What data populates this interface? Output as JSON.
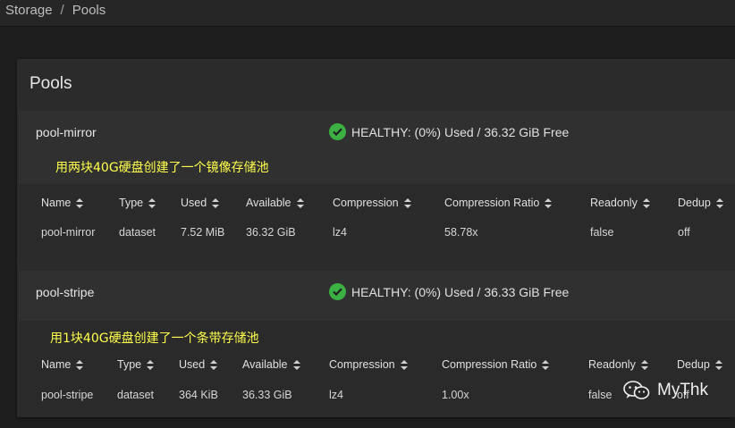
{
  "breadcrumb": {
    "items": [
      "Storage",
      "Pools"
    ],
    "separator": "/"
  },
  "card": {
    "title": "Pools"
  },
  "columns": [
    "Name",
    "Type",
    "Used",
    "Available",
    "Compression",
    "Compression Ratio",
    "Readonly",
    "Dedup"
  ],
  "pools": [
    {
      "name": "pool-mirror",
      "status": "HEALTHY: (0%) Used / 36.32 GiB Free",
      "annotation": "用两块40G硬盘创建了一个镜像存储池",
      "row": {
        "name": "pool-mirror",
        "type": "dataset",
        "used": "7.52 MiB",
        "available": "36.32 GiB",
        "compression": "lz4",
        "ratio": "58.78x",
        "readonly": "false",
        "dedup": "off"
      }
    },
    {
      "name": "pool-stripe",
      "status": "HEALTHY: (0%) Used / 36.33 GiB Free",
      "annotation": "用1块40G硬盘创建了一个条带存储池",
      "row": {
        "name": "pool-stripe",
        "type": "dataset",
        "used": "364 KiB",
        "available": "36.33 GiB",
        "compression": "lz4",
        "ratio": "1.00x",
        "readonly": "false",
        "dedup": "off"
      }
    }
  ],
  "watermark": {
    "text": "MyThk",
    "icon": "wechat-icon"
  },
  "colors": {
    "healthy": "#3cb043",
    "annotation": "#ffff4d",
    "background": "#1e1e1e",
    "card": "#2b2b2b"
  }
}
